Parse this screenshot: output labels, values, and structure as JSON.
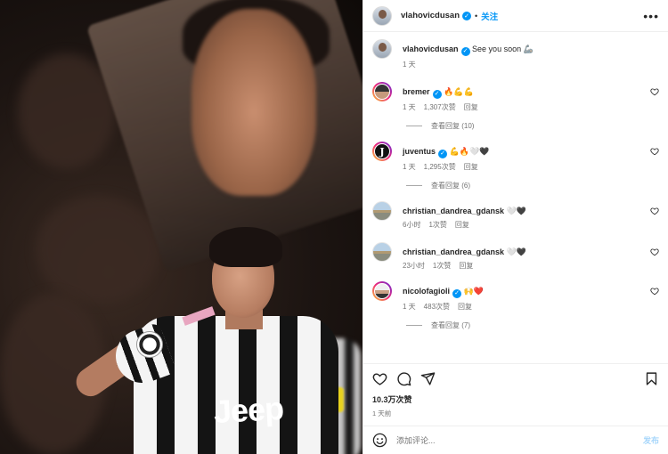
{
  "post": {
    "author": "vlahovicdusan",
    "follow_label": "关注",
    "separator": "•",
    "more_glyph": "•••",
    "caption": {
      "username": "vlahovicdusan",
      "text": "See you soon 🦾",
      "time": "1 天"
    },
    "photo": {
      "shirt_sponsor": "Jeep"
    }
  },
  "comments": [
    {
      "username": "bremer",
      "verified": true,
      "text": "🔥💪💪",
      "time": "1 天",
      "likes": "1,307次赞",
      "reply_label": "回复",
      "view_replies": "查看回复 (10)",
      "avatar_icon": "bremer-avatar"
    },
    {
      "username": "juventus",
      "verified": true,
      "text": "💪🔥🤍🖤",
      "time": "1 天",
      "likes": "1,295次赞",
      "reply_label": "回复",
      "view_replies": "查看回复 (6)",
      "avatar_icon": "juventus-logo-avatar"
    },
    {
      "username": "christian_dandrea_gdansk",
      "verified": false,
      "text": "🤍🖤",
      "time": "6小时",
      "likes": "1次赞",
      "reply_label": "回复",
      "avatar_icon": "beach-avatar"
    },
    {
      "username": "christian_dandrea_gdansk",
      "verified": false,
      "text": "🤍🖤",
      "time": "23小时",
      "likes": "1次赞",
      "reply_label": "回复",
      "avatar_icon": "beach-avatar"
    },
    {
      "username": "nicolofagioli",
      "verified": true,
      "text": "🙌❤️",
      "time": "1 天",
      "likes": "483次赞",
      "reply_label": "回复",
      "view_replies": "查看回复 (7)",
      "avatar_icon": "fagioli-avatar"
    }
  ],
  "actions": {
    "likes_total": "10.3万次赞",
    "posted_ago": "1 天前",
    "icons": [
      "heart-icon",
      "comment-icon",
      "share-icon",
      "bookmark-icon"
    ]
  },
  "add_comment": {
    "placeholder": "添加评论...",
    "post_label": "发布",
    "emoji_icon": "emoji-icon"
  },
  "colors": {
    "link_blue": "#0095f6",
    "muted": "#737373",
    "post_disabled": "#a8d7fb"
  }
}
